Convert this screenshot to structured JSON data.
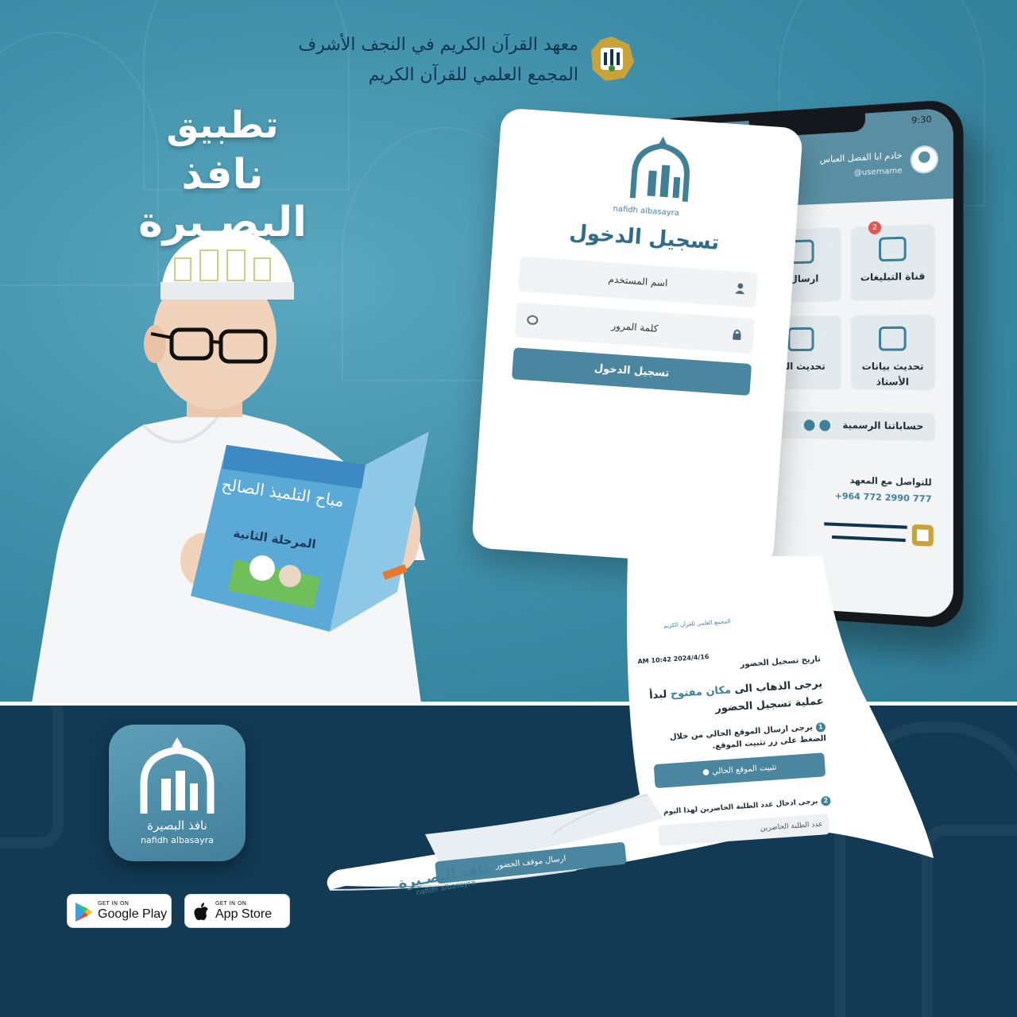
{
  "header": {
    "institute_line1": "معهد القرآن الكريم في النجف الأشرف",
    "institute_line2": "المجمع العلمي للقرآن الكريم"
  },
  "title": {
    "line1": "تطبيق",
    "line2": "نافذ البصـيرة"
  },
  "book": {
    "title": "مباح التلميذ الصالح",
    "stage": "المرحلة الثانية"
  },
  "phone": {
    "time": "9:30",
    "user_name": "خادم ابا الفضل العباس",
    "user_handle": "@username",
    "tiles": [
      {
        "label": "قناة التبليغات",
        "badge": "2"
      },
      {
        "label": "ارسال ا",
        "badge": ""
      },
      {
        "label": "تحديث بيانات الأستاذ",
        "badge": ""
      },
      {
        "label": "تحديث الط",
        "badge": ""
      }
    ],
    "accounts_label": "حساباتنا الرسمية",
    "contact_title": "للتواصل مع المعهد",
    "contact_phone": "+964 772 2990 777"
  },
  "login": {
    "logo_text": "nafidh albasayra",
    "title": "تسجيل الدخول",
    "username_placeholder": "اسم المستخدم",
    "password_placeholder": "كلمة المرور",
    "submit_label": "تسجيل الدخول"
  },
  "attendance": {
    "header": "المجمع العلمي للقرآن الكريم",
    "date": "2024/4/16  10:42 AM",
    "heading": "تاريخ تسجيل الحضور",
    "message_pre": "يرجى الذهاب الى",
    "message_highlight": "مكان مفتوح",
    "message_post": "لبدأ عملية تسجيل الحضور",
    "step1": "يرجى ارسال الموقع الحالي من خلال الضغط على زر تثبيت الموقع.",
    "step1_button": "تثبيت الموقع الحالي",
    "step2": "يرجى ادخال عدد الطلبة الحاضرين لهذا اليوم",
    "step2_field": "عدد الطلبة الحاضرين",
    "send_button": "ارسال موقف الحضور"
  },
  "paper_brand": {
    "arabic": "نافذ البصـيرة",
    "latin": "nafidh albasayra"
  },
  "app_icon": {
    "arabic": "نافذ البصيرة",
    "latin": "nafidh albasayra"
  },
  "stores": {
    "google_small": "GET IN ON",
    "google_big": "Google Play",
    "apple_small": "GET IN ON",
    "apple_big": "App Store"
  },
  "colors": {
    "accent": "#4a86a0",
    "top_background": "#3f8ea8",
    "bottom_background": "#123a55"
  }
}
